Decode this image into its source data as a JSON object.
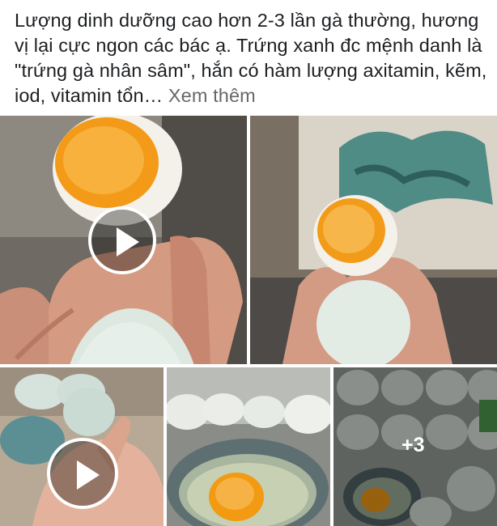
{
  "post": {
    "caption": "Lượng dinh dưỡng cao hơn 2-3 lần gà thường, hương vị lại cực ngon các bác ạ. Trứng xanh đc mệnh danh là \"trứng gà nhân sâm\", hắn có hàm lượng axitamin, kẽm, iod, vitamin tổn…",
    "see_more": "Xem thêm"
  },
  "media": {
    "tiles": [
      {
        "kind": "video",
        "icon": "play-icon"
      },
      {
        "kind": "photo"
      },
      {
        "kind": "video",
        "icon": "play-icon"
      },
      {
        "kind": "photo"
      },
      {
        "kind": "photo",
        "more_count": "+3"
      }
    ]
  },
  "colors": {
    "text": "#1c1e21",
    "muted": "#65676b",
    "yolk": "#f4a11d",
    "eggshell": "#dfe9e3"
  }
}
